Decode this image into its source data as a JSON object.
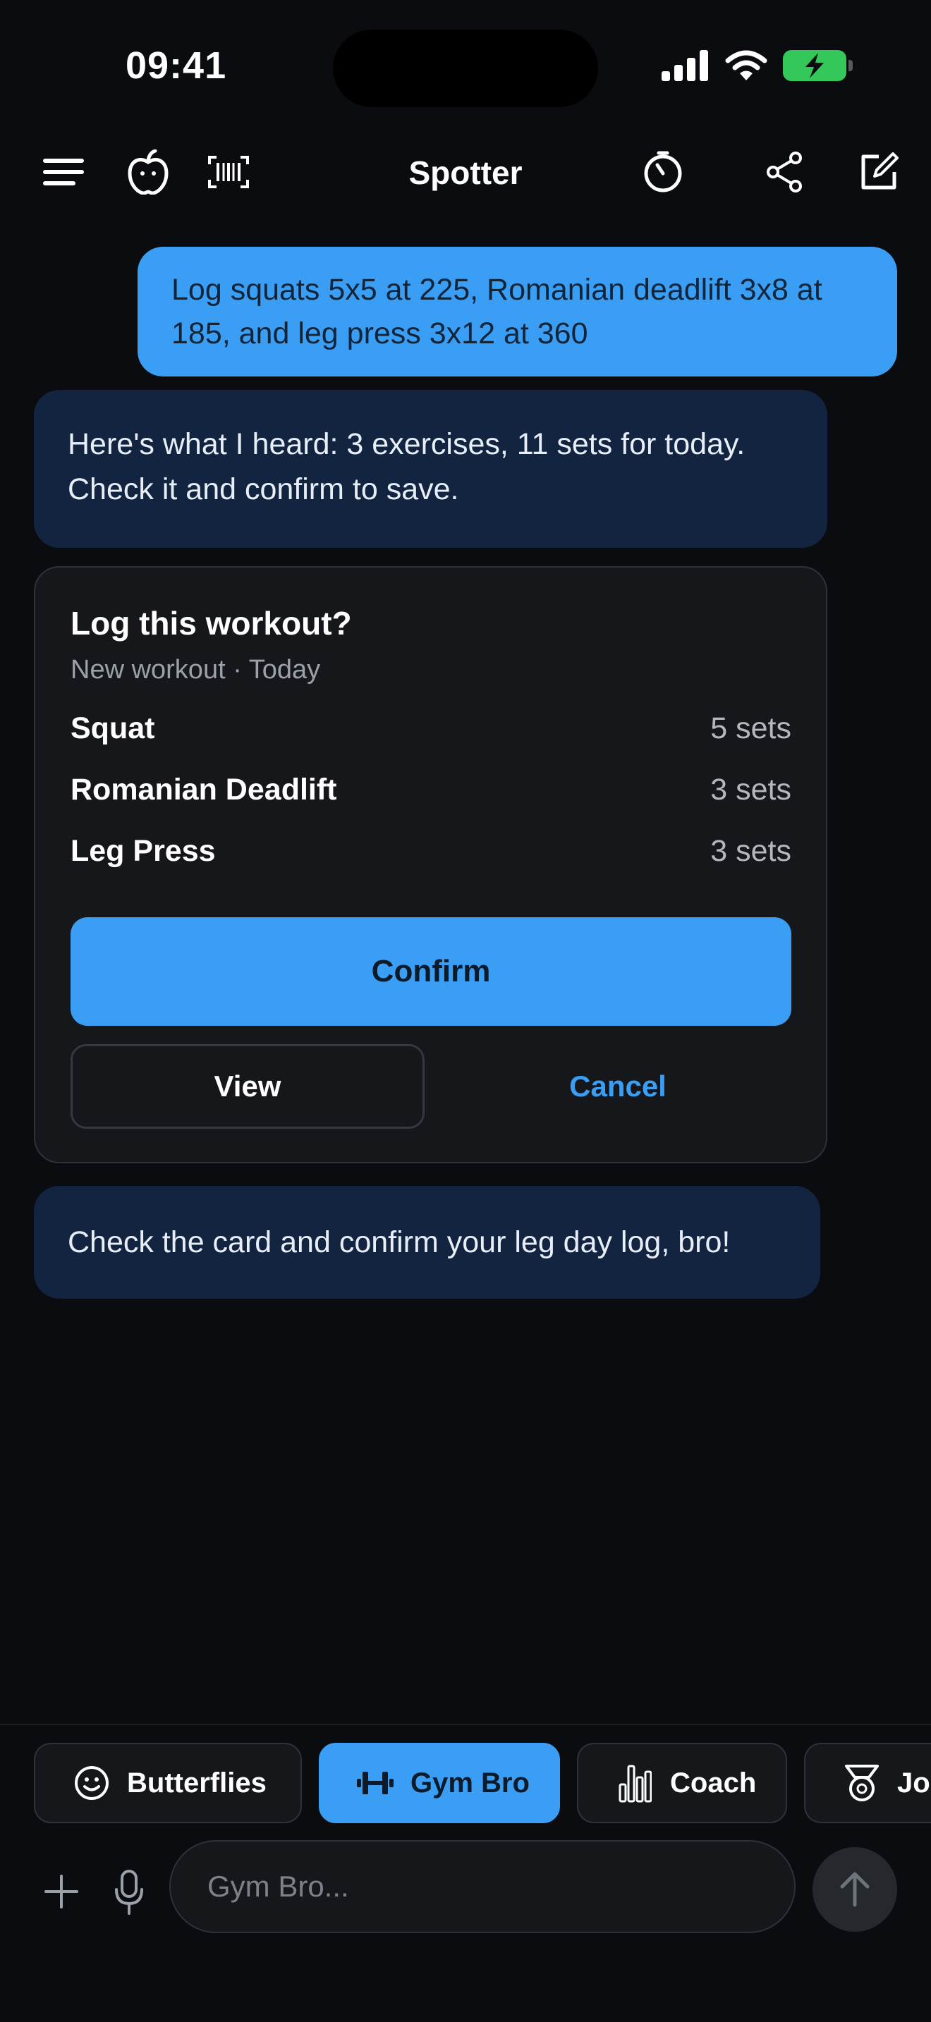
{
  "status": {
    "time": "09:41"
  },
  "header": {
    "title": "Spotter"
  },
  "messages": {
    "user": "Log squats 5x5 at 225, Romanian deadlift 3x8 at 185, and leg press 3x12 at 360",
    "bot1": "Here's what I heard: 3 exercises, 11 sets for today. Check it and confirm to save.",
    "bot2": "Check the card and confirm your leg day log, bro!"
  },
  "card": {
    "title": "Log this workout?",
    "subtitle": "New workout · Today",
    "exercises": [
      {
        "name": "Squat",
        "sets": "5 sets"
      },
      {
        "name": "Romanian Deadlift",
        "sets": "3 sets"
      },
      {
        "name": "Leg Press",
        "sets": "3 sets"
      }
    ],
    "confirm_label": "Confirm",
    "view_label": "View",
    "cancel_label": "Cancel"
  },
  "personas": [
    {
      "label": "Butterflies",
      "icon": "smiley-icon",
      "active": false
    },
    {
      "label": "Gym Bro",
      "icon": "dumbbell-icon",
      "active": true
    },
    {
      "label": "Coach",
      "icon": "bar-chart-icon",
      "active": false
    },
    {
      "label": "Joc",
      "icon": "medal-icon",
      "active": false
    }
  ],
  "composer": {
    "placeholder": "Gym Bro..."
  },
  "colors": {
    "accent": "#3b9ef5",
    "background": "#0b0c0f",
    "bot_bubble": "#132440",
    "card": "#15171b",
    "battery": "#34c759"
  }
}
